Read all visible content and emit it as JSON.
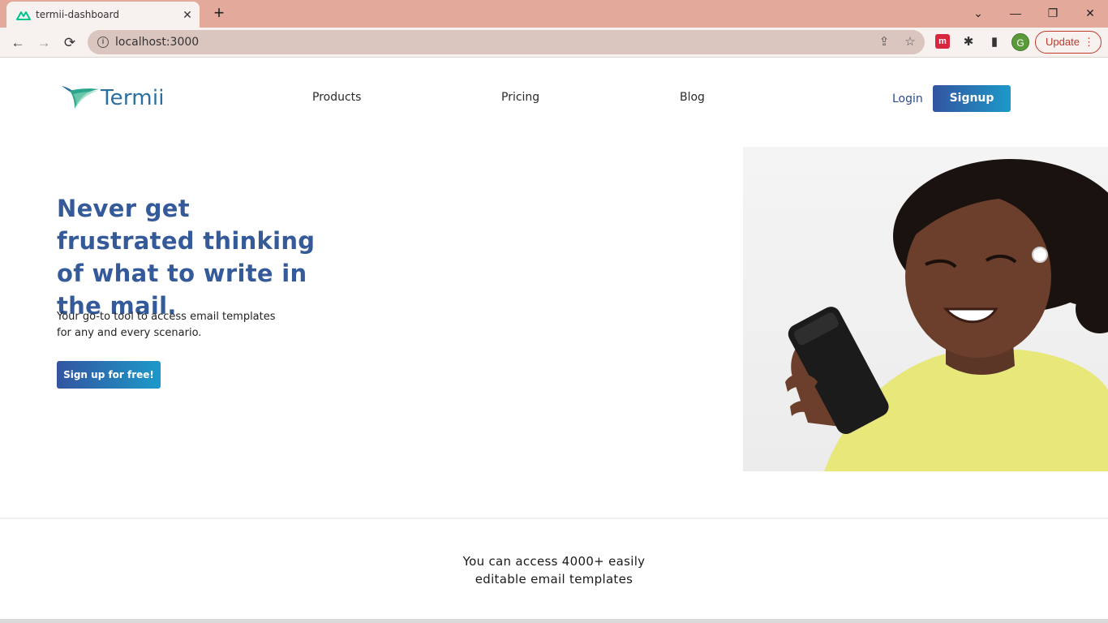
{
  "browser": {
    "tab_title": "termii-dashboard",
    "tab_close": "✕",
    "new_tab": "+",
    "url": "localhost:3000",
    "profile_initial": "G",
    "update_label": "Update",
    "update_menu": "⋮",
    "window_controls": {
      "tab_search": "⌄",
      "minimize": "—",
      "restore": "❐",
      "close": "✕"
    },
    "nav": {
      "back": "←",
      "forward": "→",
      "reload": "⟳"
    },
    "omnibox_icons": {
      "info": "i",
      "share": "⇪",
      "bookmark": "☆"
    },
    "extensions": {
      "ext_red": "m",
      "puzzle": "✱",
      "side_panel": "▮"
    }
  },
  "site": {
    "logo_text": "Termii",
    "nav": {
      "products": "Products",
      "pricing": "Pricing",
      "blog": "Blog",
      "login": "Login",
      "signup": "Signup"
    },
    "hero": {
      "title": "Never get frustrated thinking of what to write in the mail.",
      "subtitle": "Your go-to tool to access email templates for any and every scenario.",
      "cta": "Sign up for free!"
    },
    "access": {
      "line1": "You can access 4000+ easily",
      "line2": "editable email templates"
    }
  },
  "colors": {
    "brand_blue": "#355a9a",
    "button_gradient_start": "#3355a0",
    "button_gradient_end": "#1d99c9",
    "tabbar": "#e3a99a"
  }
}
